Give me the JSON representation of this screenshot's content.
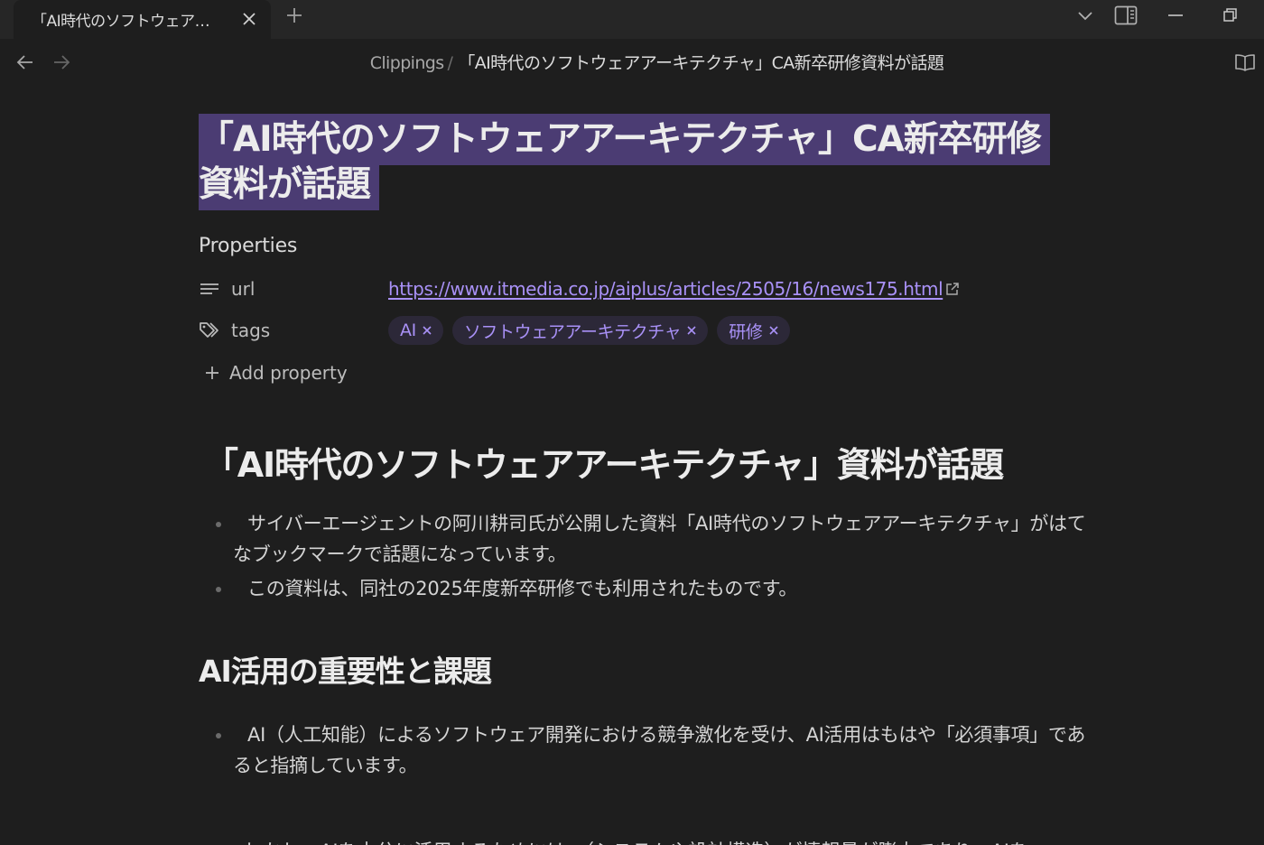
{
  "tab": {
    "title": "「AI時代のソフトウェア…"
  },
  "breadcrumb": {
    "folder": "Clippings",
    "separator": "/",
    "current": "「AI時代のソフトウェアアーキテクチャ」CA新卒研修資料が話題"
  },
  "note": {
    "title_line1": "「AI時代のソフトウェアアーキテクチャ」CA新卒研修",
    "title_line2": "資料が話題",
    "properties_heading": "Properties",
    "properties": {
      "url": {
        "key": "url",
        "value": "https://www.itmedia.co.jp/aiplus/articles/2505/16/news175.html"
      },
      "tags": {
        "key": "tags",
        "values": [
          "AI",
          "ソフトウェアアーキテクチャ",
          "研修"
        ]
      }
    },
    "add_property_label": "Add property",
    "heading1": "「AI時代のソフトウェアアーキテクチャ」資料が話題",
    "bullets1": [
      "サイバーエージェントの阿川耕司氏が公開した資料「AI時代のソフトウェアアーキテクチャ」がはてなブックマークで話題になっています。",
      "この資料は、同社の2025年度新卒研修でも利用されたものです。"
    ],
    "heading2": "AI活用の重要性と課題",
    "bullets2": [
      "AI（人工知能）によるソフトウェア開発における競争激化を受け、AI活用はもはや「必須事項」であると指摘しています。"
    ],
    "cut_line": "しかし、AIを十分に活用するためには、（システムや設計構造）が情報量が膨大であり、AIを"
  },
  "colors": {
    "background": "#1e1e1e",
    "tabbar": "#262626",
    "accent": "#a991f7",
    "title_highlight": "#4b3c73",
    "tag_background": "#2c2838"
  },
  "icons": {
    "tab_close": "close-icon",
    "new_tab": "plus-icon",
    "tab_list": "chevron-down-icon",
    "sidebar_toggle": "sidebar-right-icon",
    "minimize": "minimize-icon",
    "restore": "restore-icon",
    "back": "arrow-left-icon",
    "forward": "arrow-right-icon",
    "reading_view": "book-open-icon",
    "url_property": "text-lines-icon",
    "tags_property": "tags-icon",
    "external_link": "external-link-icon",
    "add_property": "plus-icon"
  }
}
